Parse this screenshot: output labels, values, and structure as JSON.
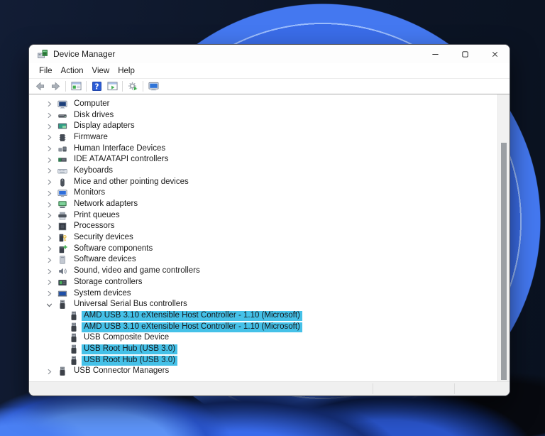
{
  "window": {
    "title": "Device Manager",
    "app_icon": "device-manager-app-icon",
    "controls": [
      {
        "name": "minimize",
        "icon": "minimize-icon"
      },
      {
        "name": "maximize",
        "icon": "maximize-icon"
      },
      {
        "name": "close",
        "icon": "close-icon"
      }
    ]
  },
  "menu": {
    "items": [
      "File",
      "Action",
      "View",
      "Help"
    ]
  },
  "toolbar": {
    "buttons": [
      {
        "type": "button",
        "name": "back",
        "icon": "arrow-left-icon"
      },
      {
        "type": "button",
        "name": "forward",
        "icon": "arrow-right-icon"
      },
      {
        "type": "separator"
      },
      {
        "type": "button",
        "name": "show-console-tree",
        "icon": "console-tree-icon"
      },
      {
        "type": "separator"
      },
      {
        "type": "button",
        "name": "help",
        "icon": "help-icon"
      },
      {
        "type": "button",
        "name": "properties",
        "icon": "properties-window-icon"
      },
      {
        "type": "separator"
      },
      {
        "type": "button",
        "name": "scan-for-hardware-changes",
        "icon": "scan-hardware-icon"
      },
      {
        "type": "separator"
      },
      {
        "type": "button",
        "name": "devices-view",
        "icon": "computer-monitor-icon"
      }
    ]
  },
  "tree": {
    "items": [
      {
        "label": "Computer",
        "icon": "computer-icon",
        "level": 0,
        "expander": "collapsed",
        "highlighted": false
      },
      {
        "label": "Disk drives",
        "icon": "disk-drive-icon",
        "level": 0,
        "expander": "collapsed",
        "highlighted": false
      },
      {
        "label": "Display adapters",
        "icon": "display-adapter-icon",
        "level": 0,
        "expander": "collapsed",
        "highlighted": false
      },
      {
        "label": "Firmware",
        "icon": "firmware-icon",
        "level": 0,
        "expander": "collapsed",
        "highlighted": false
      },
      {
        "label": "Human Interface Devices",
        "icon": "hid-icon",
        "level": 0,
        "expander": "collapsed",
        "highlighted": false
      },
      {
        "label": "IDE ATA/ATAPI controllers",
        "icon": "ide-controller-icon",
        "level": 0,
        "expander": "collapsed",
        "highlighted": false
      },
      {
        "label": "Keyboards",
        "icon": "keyboard-icon",
        "level": 0,
        "expander": "collapsed",
        "highlighted": false
      },
      {
        "label": "Mice and other pointing devices",
        "icon": "mouse-icon",
        "level": 0,
        "expander": "collapsed",
        "highlighted": false
      },
      {
        "label": "Monitors",
        "icon": "monitor-device-icon",
        "level": 0,
        "expander": "collapsed",
        "highlighted": false
      },
      {
        "label": "Network adapters",
        "icon": "network-adapter-icon",
        "level": 0,
        "expander": "collapsed",
        "highlighted": false
      },
      {
        "label": "Print queues",
        "icon": "print-queue-icon",
        "level": 0,
        "expander": "collapsed",
        "highlighted": false
      },
      {
        "label": "Processors",
        "icon": "processor-icon",
        "level": 0,
        "expander": "collapsed",
        "highlighted": false
      },
      {
        "label": "Security devices",
        "icon": "security-device-icon",
        "level": 0,
        "expander": "collapsed",
        "highlighted": false
      },
      {
        "label": "Software components",
        "icon": "software-component-icon",
        "level": 0,
        "expander": "collapsed",
        "highlighted": false
      },
      {
        "label": "Software devices",
        "icon": "software-device-icon",
        "level": 0,
        "expander": "collapsed",
        "highlighted": false
      },
      {
        "label": "Sound, video and game controllers",
        "icon": "sound-icon",
        "level": 0,
        "expander": "collapsed",
        "highlighted": false
      },
      {
        "label": "Storage controllers",
        "icon": "storage-controller-icon",
        "level": 0,
        "expander": "collapsed",
        "highlighted": false
      },
      {
        "label": "System devices",
        "icon": "system-device-icon",
        "level": 0,
        "expander": "collapsed",
        "highlighted": false
      },
      {
        "label": "Universal Serial Bus controllers",
        "icon": "usb-icon",
        "level": 0,
        "expander": "expanded",
        "highlighted": false
      },
      {
        "label": "AMD USB 3.10 eXtensible Host Controller - 1.10 (Microsoft)",
        "icon": "usb-icon",
        "level": 1,
        "expander": "none",
        "highlighted": true
      },
      {
        "label": "AMD USB 3.10 eXtensible Host Controller - 1.10 (Microsoft)",
        "icon": "usb-icon",
        "level": 1,
        "expander": "none",
        "highlighted": true
      },
      {
        "label": "USB Composite Device",
        "icon": "usb-icon",
        "level": 1,
        "expander": "none",
        "highlighted": false
      },
      {
        "label": "USB Root Hub (USB 3.0)",
        "icon": "usb-icon",
        "level": 1,
        "expander": "none",
        "highlighted": true
      },
      {
        "label": "USB Root Hub (USB 3.0)",
        "icon": "usb-icon",
        "level": 1,
        "expander": "none",
        "highlighted": true
      },
      {
        "label": "USB Connector Managers",
        "icon": "usb-icon",
        "level": 0,
        "expander": "collapsed",
        "highlighted": false
      }
    ]
  },
  "colors": {
    "highlight": "#45c1e8",
    "window_background": "#ffffff",
    "statusbar_background": "#f0f0f0",
    "wallpaper_base": "#0d1628",
    "bloom_blue": "#3a6ce8"
  }
}
